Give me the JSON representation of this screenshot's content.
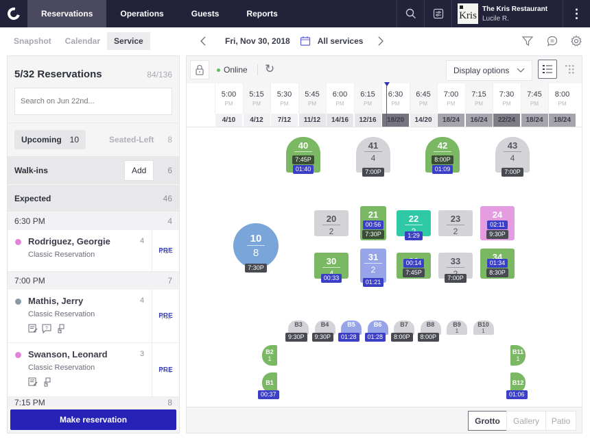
{
  "topnav": {
    "logo_icon": "app-logo-icon",
    "tabs": [
      {
        "label": "Reservations",
        "active": true
      },
      {
        "label": "Operations",
        "active": false
      },
      {
        "label": "Guests",
        "active": false
      },
      {
        "label": "Reports",
        "active": false
      }
    ],
    "icons": [
      "search-icon",
      "sliders-icon"
    ],
    "restaurant_logo_text": "Kris",
    "restaurant_name": "The Kris Restaurant",
    "user_name": "Lucile R.",
    "more_icon": "⋮"
  },
  "subnav": {
    "tabs": [
      {
        "label": "Snapshot",
        "active": false
      },
      {
        "label": "Calendar",
        "active": false
      },
      {
        "label": "Service",
        "active": true
      }
    ],
    "prev": "‹",
    "date": "Fri, Nov 30, 2018",
    "services": "All services",
    "next": "›",
    "right_icons": [
      "filter-icon",
      "chat-icon",
      "gear-icon"
    ]
  },
  "left_panel": {
    "title": "5/32 Reservations",
    "count": "84/136",
    "search_placeholder": "Search on Jun 22nd...",
    "tabs": [
      {
        "label": "Upcoming",
        "count": "10",
        "active": true
      },
      {
        "label": "Seated-Left",
        "count": "8",
        "active": false
      }
    ],
    "walkins": {
      "label": "Walk-ins",
      "add_label": "Add",
      "count": "6"
    },
    "expected": {
      "label": "Expected",
      "count": "46"
    },
    "groups": [
      {
        "time": "6:30 PM",
        "count": "4"
      },
      {
        "time": "7:00 PM",
        "count": "7"
      },
      {
        "time": "7:15 PM",
        "count": "8"
      }
    ],
    "reservations": [
      {
        "name": "Rodriguez, Georgie",
        "party": "4",
        "type": "Classic Reservation",
        "status": "PRE",
        "table": "T 24",
        "dot_color": "#e085d8",
        "tags": []
      },
      {
        "name": "Mathis, Jerry",
        "party": "4",
        "type": "Classic Reservation",
        "status": "PRE",
        "table": "T43",
        "dot_color": "#8a9aa2",
        "tags": [
          "note-icon",
          "question-icon",
          "hand-icon"
        ]
      },
      {
        "name": "Swanson, Leonard",
        "party": "3",
        "type": "Classic Reservation",
        "status": "PRE",
        "table": "T 41",
        "dot_color": "#e085d8",
        "tags": [
          "note-icon",
          "hand-icon"
        ]
      }
    ],
    "make_reservation": "Make reservation"
  },
  "toolbar": {
    "lock_icon": "lock-icon",
    "status": "Online",
    "refresh_icon": "↻",
    "display_options": "Display options",
    "view_icons": [
      "list-view-icon",
      "grid-view-icon"
    ]
  },
  "timeline": {
    "slots": [
      {
        "time": "5:00",
        "ampm": "PM",
        "covers": "4/10"
      },
      {
        "time": "5:15",
        "ampm": "PM",
        "covers": "4/12"
      },
      {
        "time": "5:30",
        "ampm": "PM",
        "covers": "7/12"
      },
      {
        "time": "5:45",
        "ampm": "PM",
        "covers": "11/12"
      },
      {
        "time": "6:00",
        "ampm": "PM",
        "covers": "14/16"
      },
      {
        "time": "6:15",
        "ampm": "PM",
        "covers": "12/16"
      },
      {
        "time": "6:30",
        "ampm": "PM",
        "covers": "18/20"
      },
      {
        "time": "6:45",
        "ampm": "PM",
        "covers": "14/20"
      },
      {
        "time": "7:00",
        "ampm": "PM",
        "covers": "18/24"
      },
      {
        "time": "7:15",
        "ampm": "PM",
        "covers": "16/24"
      },
      {
        "time": "7:30",
        "ampm": "PM",
        "covers": "22/24"
      },
      {
        "time": "7:45",
        "ampm": "PM",
        "covers": "18/24"
      },
      {
        "time": "8:00",
        "ampm": "PM",
        "covers": "18/24"
      }
    ],
    "current_time_index": 6
  },
  "floor": {
    "tables": [
      {
        "id": "40",
        "size": "",
        "status": "green",
        "badges": [
          {
            "text": "7:45P",
            "style": "dkgreen"
          },
          {
            "text": "01:40",
            "style": "blue"
          }
        ]
      },
      {
        "id": "41",
        "size": "4",
        "status": "grey",
        "badges": [
          {
            "text": "7:00P",
            "style": "dark"
          }
        ]
      },
      {
        "id": "42",
        "size": "",
        "status": "green",
        "badges": [
          {
            "text": "8:00P",
            "style": "dkgreen"
          },
          {
            "text": "01:09",
            "style": "blue"
          }
        ]
      },
      {
        "id": "43",
        "size": "4",
        "status": "grey",
        "badges": [
          {
            "text": "7:00P",
            "style": "dark"
          }
        ]
      },
      {
        "id": "10",
        "size": "8",
        "status": "round-blue",
        "badges": [
          {
            "text": "7:30P",
            "style": "dark"
          }
        ]
      },
      {
        "id": "20",
        "size": "2",
        "status": "grey",
        "badges": []
      },
      {
        "id": "21",
        "size": "",
        "status": "green",
        "badges": [
          {
            "text": "00:56",
            "style": "blue"
          },
          {
            "text": "7:30P",
            "style": "dkgreen"
          }
        ]
      },
      {
        "id": "22",
        "size": "2",
        "status": "teal",
        "badges": [
          {
            "text": "1:29",
            "style": "blue"
          }
        ]
      },
      {
        "id": "23",
        "size": "2",
        "status": "grey",
        "badges": []
      },
      {
        "id": "24",
        "size": "",
        "status": "pink",
        "badges": [
          {
            "text": "02:11",
            "style": "blue"
          },
          {
            "text": "9:30P",
            "style": "dark"
          }
        ]
      },
      {
        "id": "30",
        "size": "4",
        "status": "green",
        "badges": [
          {
            "text": "00:33",
            "style": "blue"
          }
        ]
      },
      {
        "id": "31",
        "size": "2",
        "status": "lavender",
        "badges": [
          {
            "text": "01:21",
            "style": "blue"
          }
        ]
      },
      {
        "id": "32",
        "size": "",
        "status": "green",
        "badges": [
          {
            "text": "00:14",
            "style": "blue"
          },
          {
            "text": "7:45P",
            "style": "dark"
          }
        ]
      },
      {
        "id": "33",
        "size": "2",
        "status": "grey",
        "badges": [
          {
            "text": "7:00P",
            "style": "dark"
          }
        ]
      },
      {
        "id": "34",
        "size": "",
        "status": "green",
        "badges": [
          {
            "text": "01:34",
            "style": "blue"
          },
          {
            "text": "8:30P",
            "style": "dark"
          }
        ]
      }
    ],
    "bar_seats": [
      {
        "id": "B3",
        "size": "",
        "status": "grey",
        "badge": {
          "text": "9:30P",
          "style": "dark"
        }
      },
      {
        "id": "B4",
        "size": "",
        "status": "grey",
        "badge": {
          "text": "9:30P",
          "style": "dark"
        }
      },
      {
        "id": "B5",
        "size": "",
        "status": "lavender",
        "badge": {
          "text": "01:28",
          "style": "blue"
        }
      },
      {
        "id": "B6",
        "size": "",
        "status": "lavender",
        "badge": {
          "text": "01:28",
          "style": "blue"
        }
      },
      {
        "id": "B7",
        "size": "",
        "status": "grey",
        "badge": {
          "text": "8:00P",
          "style": "dark"
        }
      },
      {
        "id": "B8",
        "size": "",
        "status": "grey",
        "badge": {
          "text": "8:00P",
          "style": "dark"
        }
      },
      {
        "id": "B9",
        "size": "1",
        "status": "grey",
        "badge": null
      },
      {
        "id": "B10",
        "size": "1",
        "status": "grey",
        "badge": null
      }
    ],
    "side_seats": [
      {
        "id": "B2",
        "size": "1",
        "status": "green",
        "badge": null
      },
      {
        "id": "B1",
        "size": "",
        "status": "green",
        "badge": {
          "text": "00:37",
          "style": "blue"
        }
      },
      {
        "id": "B11",
        "size": "1",
        "status": "green",
        "badge": null
      },
      {
        "id": "B12",
        "size": "",
        "status": "green",
        "badge": {
          "text": "01:06",
          "style": "blue"
        }
      }
    ]
  },
  "rooms": [
    {
      "label": "Grotto",
      "active": true
    },
    {
      "label": "Gallery",
      "active": false
    },
    {
      "label": "Patio",
      "active": false
    }
  ]
}
